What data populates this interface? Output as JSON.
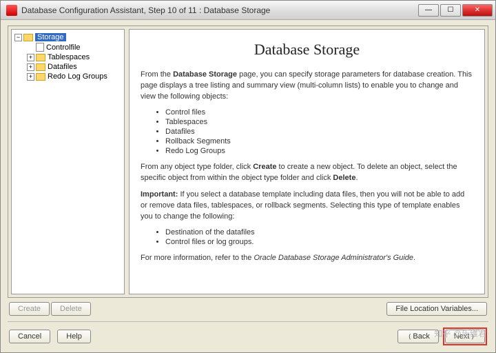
{
  "window": {
    "title": "Database Configuration Assistant, Step 10 of 11 : Database Storage"
  },
  "tree": {
    "root": "Storage",
    "items": [
      {
        "label": "Controlfile",
        "expandable": false
      },
      {
        "label": "Tablespaces",
        "expandable": true
      },
      {
        "label": "Datafiles",
        "expandable": true
      },
      {
        "label": "Redo Log Groups",
        "expandable": true
      }
    ]
  },
  "body": {
    "heading": "Database Storage",
    "p1_a": "From the ",
    "p1_b": "Database Storage",
    "p1_c": " page, you can specify storage parameters for database creation. This page displays a tree listing and summary view (multi-column lists) to enable you to change and view the following objects:",
    "list1": [
      "Control files",
      "Tablespaces",
      "Datafiles",
      "Rollback Segments",
      "Redo Log Groups"
    ],
    "p2_a": "From any object type folder, click ",
    "p2_b": "Create",
    "p2_c": " to create a new object. To delete an object, select the specific object from within the object type folder and click ",
    "p2_d": "Delete",
    "p2_e": ".",
    "p3_a": "Important:",
    "p3_b": " If you select a database template including data files, then you will not be able to add or remove data files, tablespaces, or rollback segments. Selecting this type of template enables you to change the following:",
    "list2": [
      "Destination of the datafiles",
      "Control files or log groups."
    ],
    "p4_a": "For more information, refer to the ",
    "p4_b": "Oracle Database Storage Administrator's Guide",
    "p4_c": "."
  },
  "buttons": {
    "create": "Create",
    "delete": "Delete",
    "file_loc": "File Location Variables...",
    "cancel": "Cancel",
    "help": "Help",
    "back": "Back",
    "next": "Next"
  },
  "watermark": "知乎 @乐维君"
}
